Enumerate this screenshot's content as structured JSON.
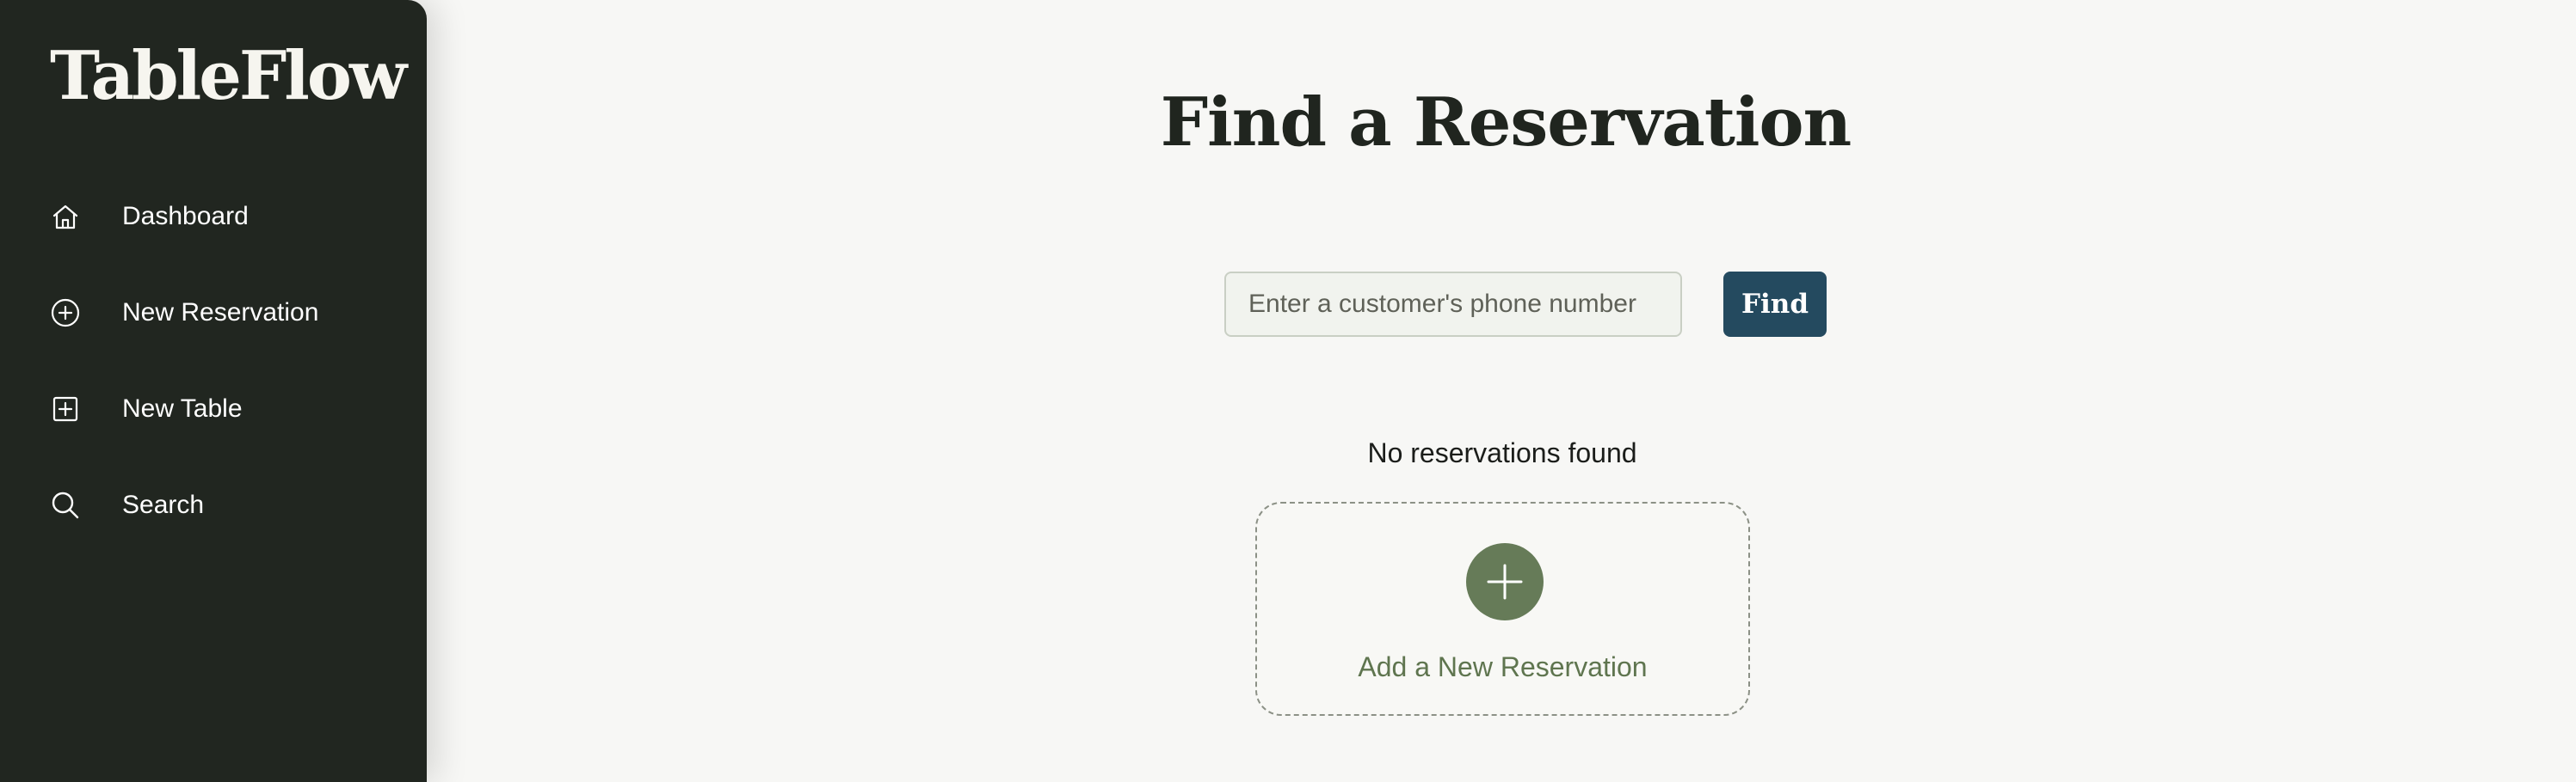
{
  "app": {
    "brand": "TableFlow"
  },
  "sidebar": {
    "items": [
      {
        "label": "Dashboard",
        "icon": "home-icon"
      },
      {
        "label": "New Reservation",
        "icon": "plus-circle-icon"
      },
      {
        "label": "New Table",
        "icon": "plus-square-icon"
      },
      {
        "label": "Search",
        "icon": "search-icon"
      }
    ]
  },
  "main": {
    "title": "Find a Reservation",
    "search": {
      "placeholder": "Enter a customer's phone number",
      "value": "",
      "button_label": "Find"
    },
    "empty_state": {
      "message": "No reservations found",
      "add_label": "Add a New Reservation"
    }
  },
  "colors": {
    "sidebar_background": "#212620",
    "page_background": "#f7f7f5",
    "primary_button": "#244a5f",
    "add_accent": "#667b58",
    "add_label": "#5f754f"
  }
}
